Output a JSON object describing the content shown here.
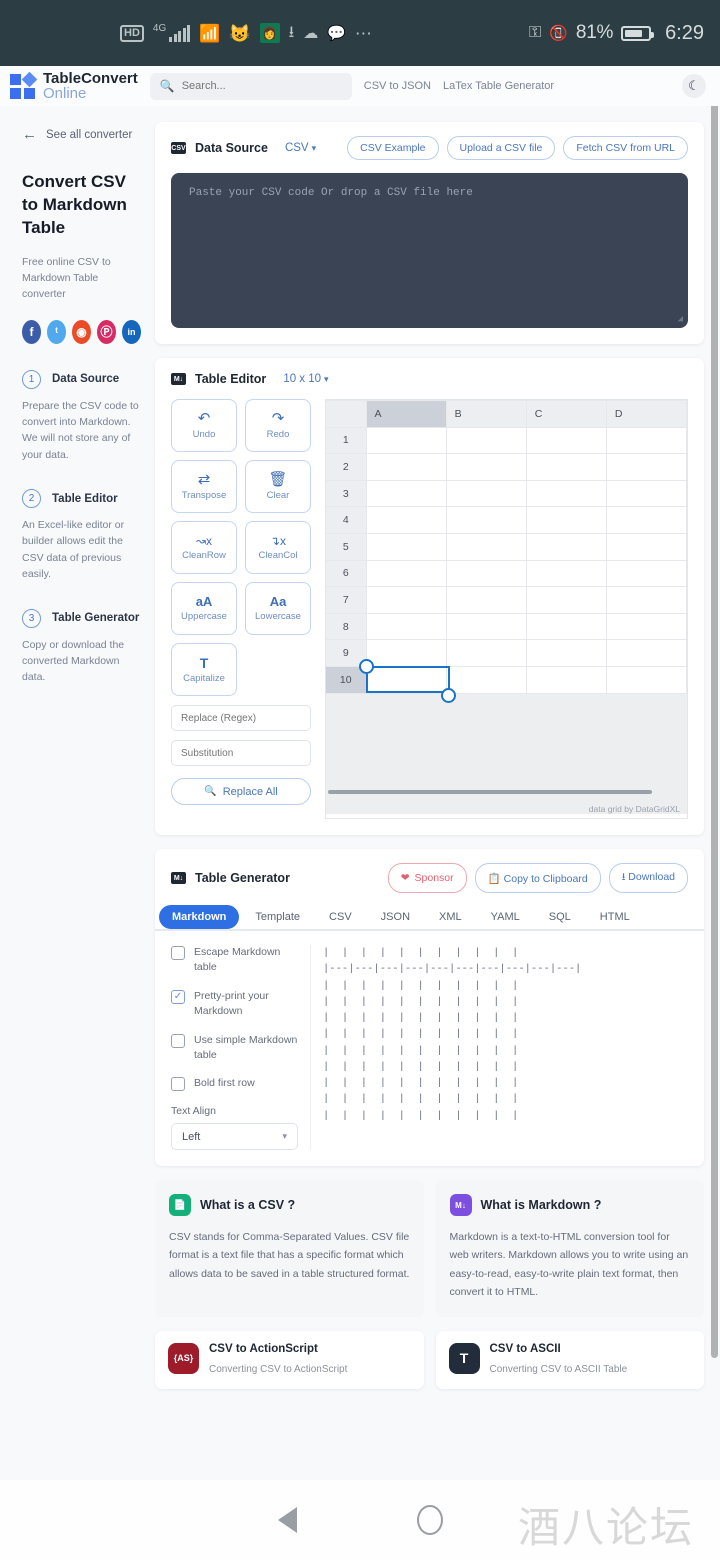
{
  "status_bar": {
    "hd": "HD",
    "network": "4G",
    "battery_percent": "81%",
    "clock": "6:29",
    "icons": [
      "hd-icon",
      "4g-signal-icon",
      "wifi-icon",
      "cat-icon",
      "avatar-icon",
      "download-icon",
      "cloud-icon",
      "wechat-icon",
      "overflow-dots-icon",
      "key-icon",
      "vibrate-icon",
      "battery-icon"
    ]
  },
  "topnav": {
    "brand_line1": "TableConvert",
    "brand_line2": "Online",
    "search_placeholder": "Search...",
    "links": [
      "CSV to JSON",
      "LaTex Table Generator"
    ],
    "theme_toggle": "☾"
  },
  "sidebar": {
    "back_label": "See all converter",
    "title": "Convert CSV to Markdown Table",
    "subtitle": "Free online CSV to Markdown Table converter",
    "socials": [
      {
        "name": "facebook",
        "glyph": "f",
        "color": "#3b5ca8"
      },
      {
        "name": "twitter",
        "glyph": "ᵗ",
        "color": "#4fa9ec"
      },
      {
        "name": "reddit",
        "glyph": "◉",
        "color": "#ec4b28"
      },
      {
        "name": "pinterest",
        "glyph": "Ⓟ",
        "color": "#d62b64"
      },
      {
        "name": "linkedin",
        "glyph": "in",
        "color": "#1566bd"
      }
    ],
    "steps": [
      {
        "num": "1",
        "label": "Data Source",
        "desc": "Prepare the CSV code to convert into Markdown. We will not store any of your data."
      },
      {
        "num": "2",
        "label": "Table Editor",
        "desc": "An Excel-like editor or builder allows edit the CSV data of previous easily."
      },
      {
        "num": "3",
        "label": "Table Generator",
        "desc": "Copy or download the converted Markdown data."
      }
    ]
  },
  "data_source": {
    "title": "Data Source",
    "format": "CSV",
    "buttons": [
      "CSV Example",
      "Upload a CSV file",
      "Fetch CSV from URL"
    ],
    "textarea_placeholder": "Paste your CSV code Or drop a CSV file here",
    "textarea_value": ""
  },
  "table_editor": {
    "title": "Table Editor",
    "dimensions": "10 x 10",
    "tools": [
      {
        "label": "Undo",
        "icon": "undo-icon",
        "glyph": "↶"
      },
      {
        "label": "Redo",
        "icon": "redo-icon",
        "glyph": "↷"
      },
      {
        "label": "Transpose",
        "icon": "transpose-icon",
        "glyph": "⇄"
      },
      {
        "label": "Clear",
        "icon": "trash-icon",
        "glyph": "Ὕ1"
      },
      {
        "label": "CleanRow",
        "icon": "clean-row-icon",
        "glyph": "⎓x"
      },
      {
        "label": "CleanCol",
        "icon": "clean-col-icon",
        "glyph": "⨻x"
      },
      {
        "label": "Uppercase",
        "icon": "uppercase-icon",
        "glyph": "aA"
      },
      {
        "label": "Lowercase",
        "icon": "lowercase-icon",
        "glyph": "Aa"
      },
      {
        "label": "Capitalize",
        "icon": "capitalize-icon",
        "glyph": "T"
      }
    ],
    "replace_placeholder": "Replace (Regex)",
    "substitution_placeholder": "Substitution",
    "replace_value": "",
    "substitution_value": "",
    "replace_all_label": "Replace All",
    "columns": [
      "A",
      "B",
      "C",
      "D"
    ],
    "rows": [
      "1",
      "2",
      "3",
      "4",
      "5",
      "6",
      "7",
      "8",
      "9",
      "10"
    ],
    "selected_cell": "A10",
    "selected_column": "A",
    "credit": "data grid by DataGridXL"
  },
  "table_generator": {
    "title": "Table Generator",
    "sponsor_label": "Sponsor",
    "copy_label": "Copy to Clipboard",
    "download_label": "Download",
    "tabs": [
      "Markdown",
      "Template",
      "CSV",
      "JSON",
      "XML",
      "YAML",
      "SQL",
      "HTML"
    ],
    "active_tab": "Markdown",
    "options": [
      {
        "label": "Escape Markdown table",
        "checked": false
      },
      {
        "label": "Pretty-print your Markdown",
        "checked": true
      },
      {
        "label": "Use simple Markdown table",
        "checked": false
      },
      {
        "label": "Bold first row",
        "checked": false
      }
    ],
    "align_label": "Text Align",
    "align_value": "Left",
    "output": "|  |  |  |  |  |  |  |  |  |  |\n|---|---|---|---|---|---|---|---|---|---|\n|  |  |  |  |  |  |  |  |  |  |\n|  |  |  |  |  |  |  |  |  |  |\n|  |  |  |  |  |  |  |  |  |  |\n|  |  |  |  |  |  |  |  |  |  |\n|  |  |  |  |  |  |  |  |  |  |\n|  |  |  |  |  |  |  |  |  |  |\n|  |  |  |  |  |  |  |  |  |  |\n|  |  |  |  |  |  |  |  |  |  |\n|  |  |  |  |  |  |  |  |  |  |"
  },
  "info_cards": [
    {
      "title": "What is a CSV ?",
      "icon": "csv-file-icon",
      "color": "#14b07a",
      "text": "CSV stands for Comma-Separated Values. CSV file format is a text file that has a specific format which allows data to be saved in a table structured format."
    },
    {
      "title": "What is Markdown ?",
      "icon": "markdown-icon",
      "color": "#7c4fe0",
      "text": "Markdown is a text-to-HTML conversion tool for web writers. Markdown allows you to write using an easy-to-read, easy-to-write plain text format, then convert it to HTML."
    }
  ],
  "converter_cards": [
    {
      "title": "CSV to ActionScript",
      "glyph": "{AS}",
      "color": "#9e1b2a",
      "desc": "Converting CSV to ActionScript"
    },
    {
      "title": "CSV to ASCII",
      "glyph": "T",
      "color": "#232c3b",
      "desc": "Converting CSV to ASCII Table"
    }
  ],
  "navbar": {
    "back": "back-button",
    "home": "home-button",
    "watermark": "酒八论坛"
  }
}
